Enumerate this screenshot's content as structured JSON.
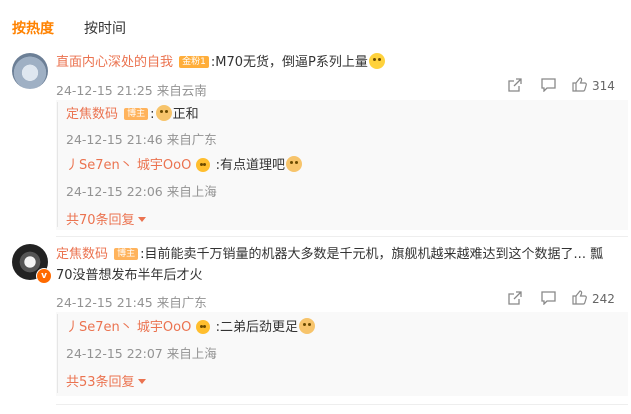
{
  "tabs": {
    "hot": "按热度",
    "time": "按时间"
  },
  "comments": [
    {
      "author": "直面内心深处的自我",
      "badge": "金粉1",
      "text": ":M70无货，倒逼P系列上量",
      "meta": "24-12-15 21:25 来自云南",
      "likes": "314",
      "replies": [
        {
          "author": "定焦数码",
          "badge": "博主",
          "text": ":",
          "text2": "正和",
          "meta": "24-12-15 21:46 来自广东"
        },
        {
          "author": "丿Se7en丶 城宇OoO",
          "text": ":有点道理吧",
          "meta": "24-12-15 22:06 来自上海"
        }
      ],
      "more": "共70条回复"
    },
    {
      "author": "定焦数码",
      "badge": "博主",
      "text_line1": ":目前能卖千万销量的机器大多数是千元机，旗舰机越来越难达到这个数据了... 瓢",
      "text_line2": "70没普想发布半年后才火",
      "meta": "24-12-15 21:45 来自广东",
      "likes": "242",
      "replies": [
        {
          "author": "丿Se7en丶 城宇OoO",
          "text": ":二弟后劲更足",
          "meta": "24-12-15 22:07 来自上海"
        }
      ],
      "more": "共53条回复"
    }
  ]
}
